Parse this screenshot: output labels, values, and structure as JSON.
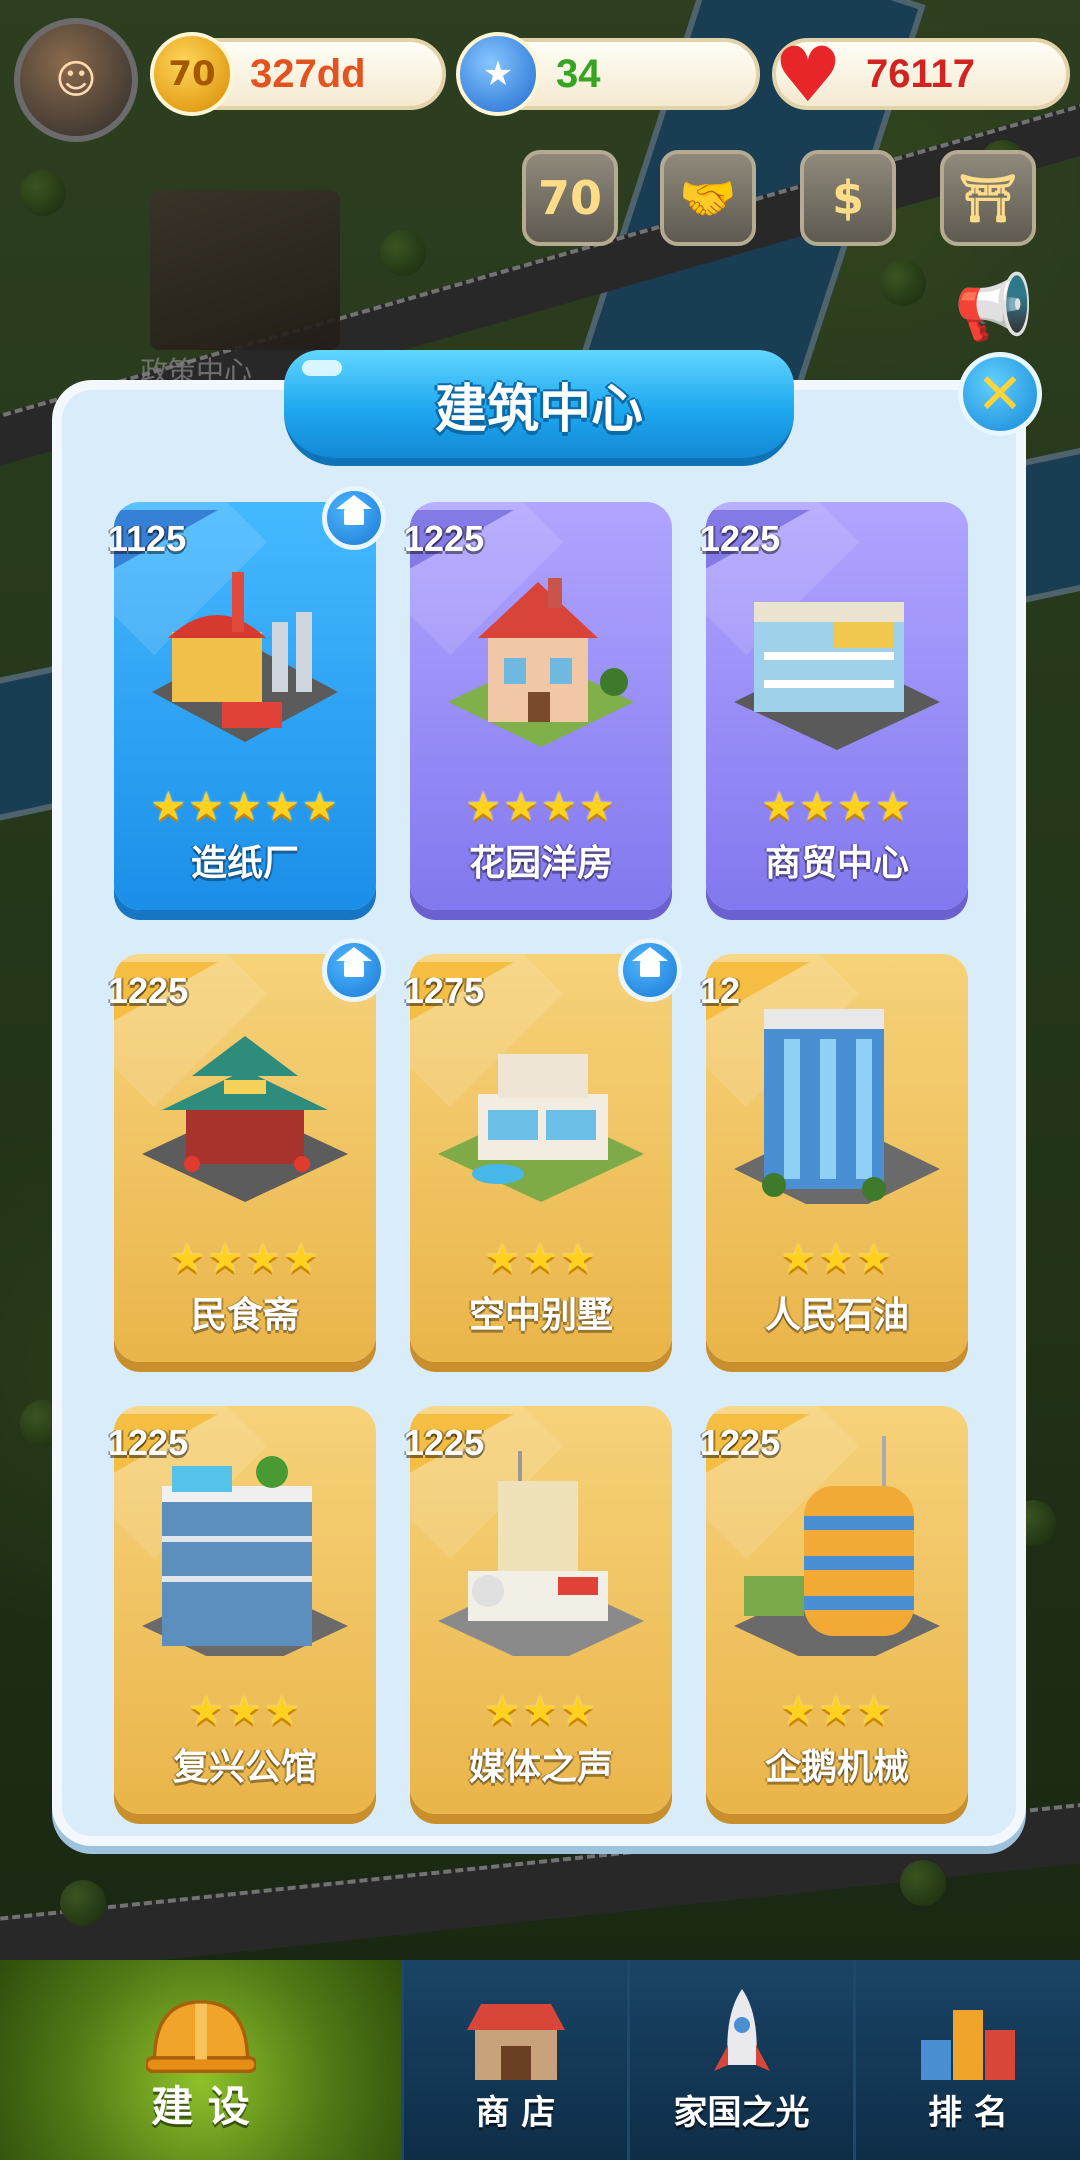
{
  "resources": {
    "coins": "327dd",
    "coin_icon_text": "70",
    "stars": "34",
    "hearts": "76117"
  },
  "quick_icons": [
    {
      "name": "promo-70-icon",
      "text": "70"
    },
    {
      "name": "handshake-icon",
      "text": "🤝"
    },
    {
      "name": "event-icon",
      "text": "$"
    },
    {
      "name": "pagoda-icon",
      "text": "⛩"
    }
  ],
  "map": {
    "building_label": "政策中心"
  },
  "modal": {
    "title": "建筑中心",
    "close_symbol": "✕"
  },
  "cards": [
    {
      "number": "1125",
      "name": "造纸厂",
      "stars": 5,
      "star_text": "★★★★★",
      "style": "blue",
      "home": true
    },
    {
      "number": "1225",
      "name": "花园洋房",
      "stars": 4,
      "star_text": "★★★★",
      "style": "purple",
      "home": false
    },
    {
      "number": "1225",
      "name": "商贸中心",
      "stars": 4,
      "star_text": "★★★★",
      "style": "purple",
      "home": false
    },
    {
      "number": "1225",
      "name": "民食斋",
      "stars": 4,
      "star_text": "★★★★",
      "style": "gold",
      "home": true
    },
    {
      "number": "1275",
      "name": "空中别墅",
      "stars": 3,
      "star_text": "★★★",
      "style": "gold",
      "home": true
    },
    {
      "number": "12",
      "name": "人民石油",
      "stars": 3,
      "star_text": "★★★",
      "style": "gold",
      "home": false
    },
    {
      "number": "1225",
      "name": "复兴公馆",
      "stars": 3,
      "star_text": "★★★",
      "style": "gold",
      "home": false
    },
    {
      "number": "1225",
      "name": "媒体之声",
      "stars": 3,
      "star_text": "★★★",
      "style": "gold",
      "home": false
    },
    {
      "number": "1225",
      "name": "企鹅机械",
      "stars": 3,
      "star_text": "★★★",
      "style": "gold",
      "home": false
    }
  ],
  "nav": [
    {
      "label": "建 设",
      "icon": "hardhat-icon",
      "active": true
    },
    {
      "label": "商 店",
      "icon": "shop-icon",
      "active": false
    },
    {
      "label": "家国之光",
      "icon": "rocket-icon",
      "active": false
    },
    {
      "label": "排 名",
      "icon": "ranking-icon",
      "active": false
    }
  ],
  "colors": {
    "title_blue": "#1ea8ef",
    "card_blue": "#1b8fe8",
    "card_purple": "#8278ef",
    "card_gold": "#eab54a",
    "star": "#ffd21f",
    "nav_active": "#6c9f1f"
  }
}
